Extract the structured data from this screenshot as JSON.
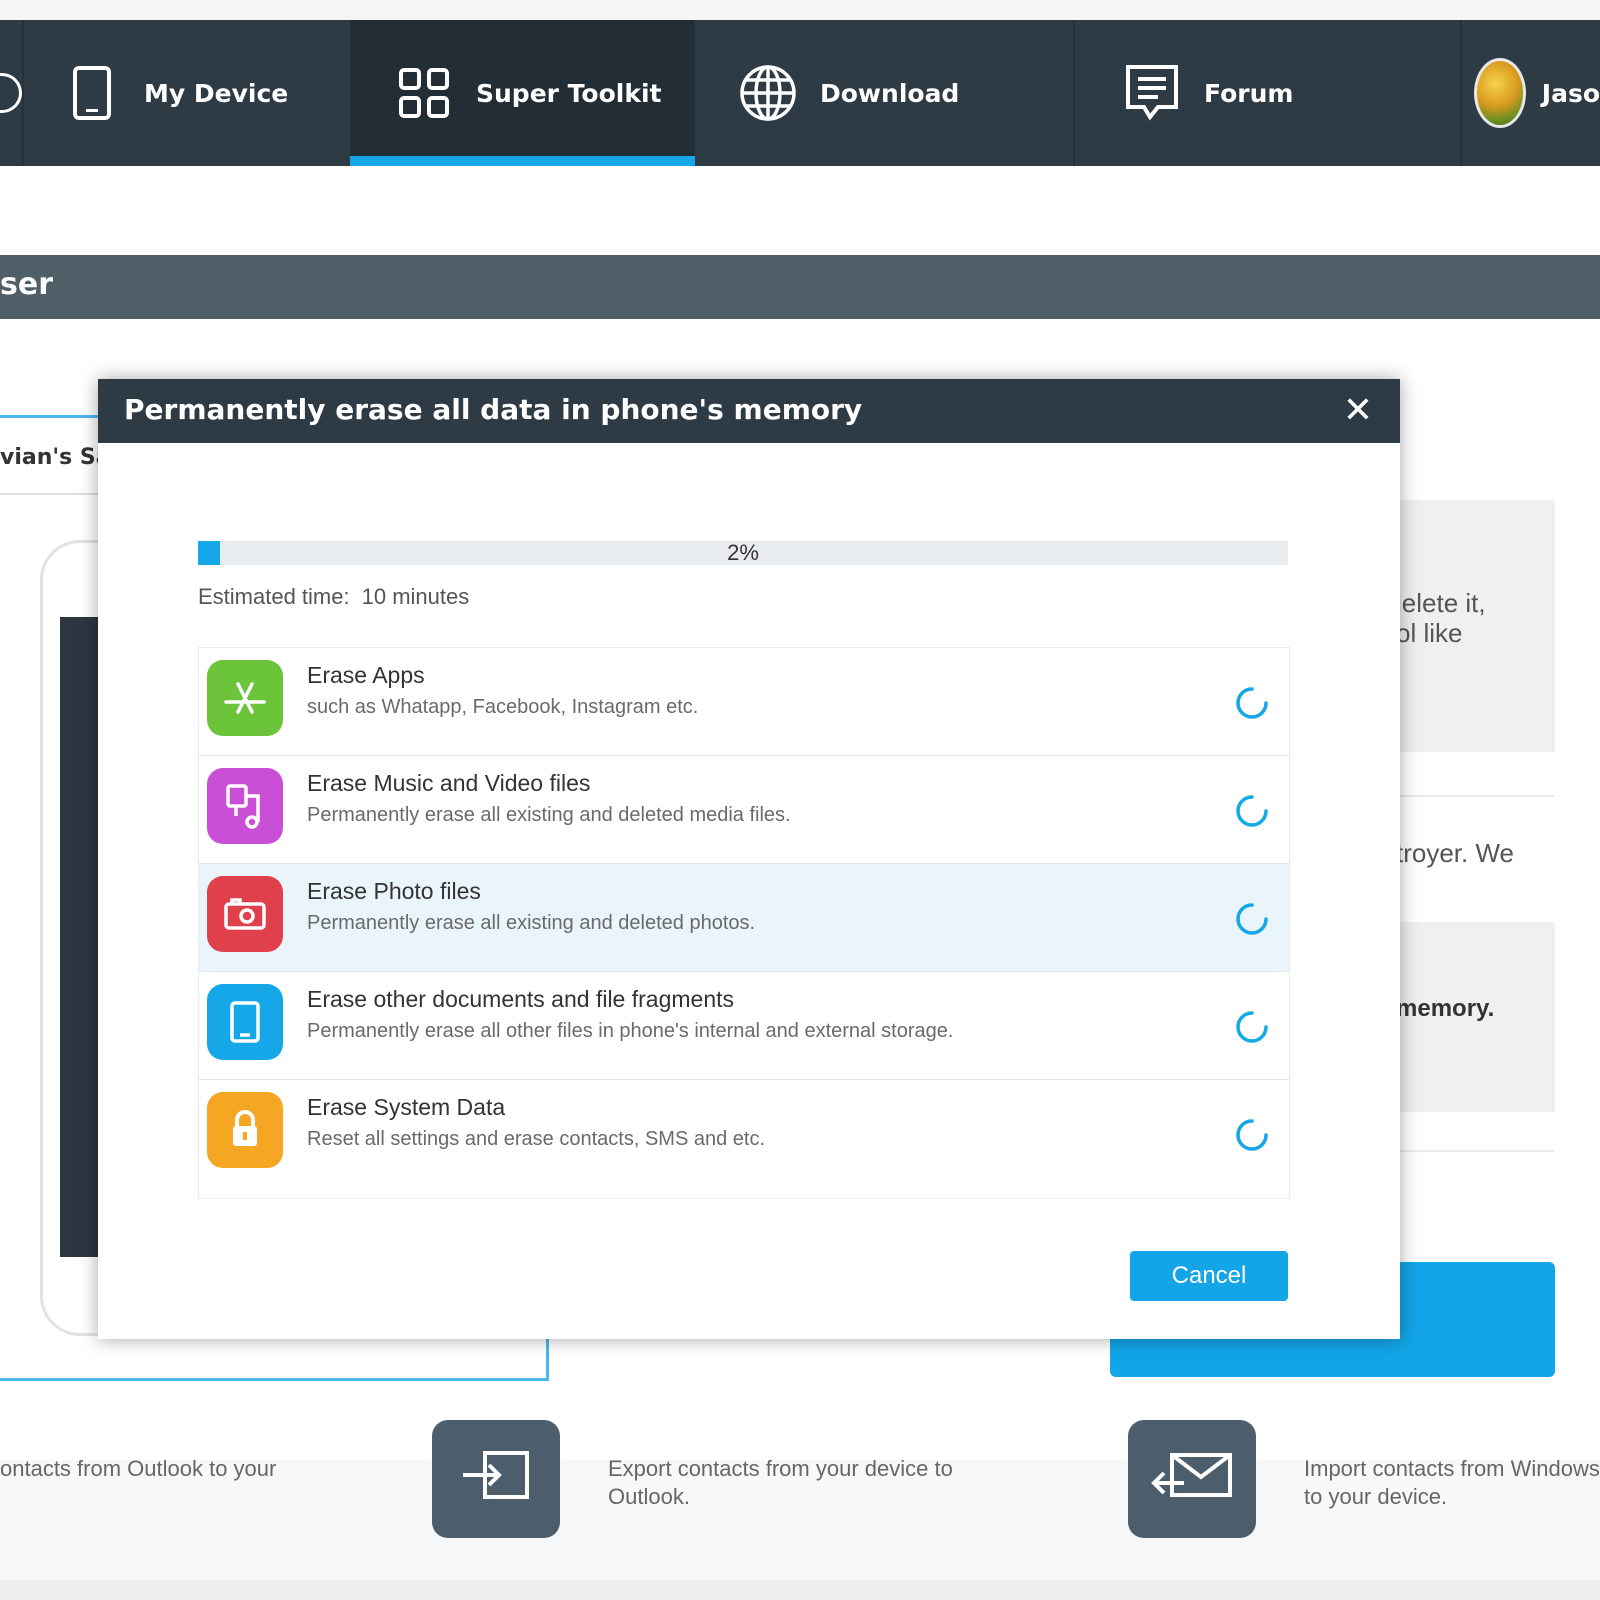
{
  "nav": {
    "items": [
      {
        "label": "My Device",
        "icon": "phone-icon"
      },
      {
        "label": "Super Toolkit",
        "icon": "grid-icon",
        "active": true
      },
      {
        "label": "Download",
        "icon": "globe-icon"
      },
      {
        "label": "Forum",
        "icon": "chat-icon"
      }
    ],
    "user_name": "Jaso"
  },
  "section_title": "ser",
  "background": {
    "device_name": "vian's Sa",
    "right_text_1": "lelete it,",
    "right_text_2": "ol like",
    "right_text_3": "troyer. We",
    "right_text_4": "memory.",
    "bottom": [
      {
        "text": "ontacts from Outlook to your"
      },
      {
        "text": "Export contacts from your device to Outlook."
      },
      {
        "text": "Import contacts from Windows to your device."
      }
    ]
  },
  "dialog": {
    "title": "Permanently erase all data in phone's memory",
    "close_symbol": "✕",
    "progress": {
      "percent": 2,
      "label": "2%"
    },
    "estimated_label": "Estimated time:",
    "estimated_value": "10 minutes",
    "items": [
      {
        "title": "Erase Apps",
        "desc": "such as Whatapp, Facebook, Instagram etc.",
        "color": "#6cc43a",
        "icon": "app-store-icon"
      },
      {
        "title": "Erase Music and Video files",
        "desc": "Permanently erase all existing and deleted media files.",
        "color": "#c94fd6",
        "icon": "music-video-icon"
      },
      {
        "title": "Erase Photo files",
        "desc": "Permanently erase all existing and deleted photos.",
        "color": "#e0404c",
        "icon": "camera-icon"
      },
      {
        "title": "Erase other documents and file fragments",
        "desc": "Permanently erase all other files in phone's internal and external storage.",
        "color": "#16a7e8",
        "icon": "phone-icon"
      },
      {
        "title": "Erase System Data",
        "desc": "Reset all settings and erase contacts, SMS and etc.",
        "color": "#f5a623",
        "icon": "lock-icon"
      }
    ],
    "cancel_label": "Cancel"
  },
  "colors": {
    "accent": "#16a7e8",
    "header": "#2e3a44"
  }
}
